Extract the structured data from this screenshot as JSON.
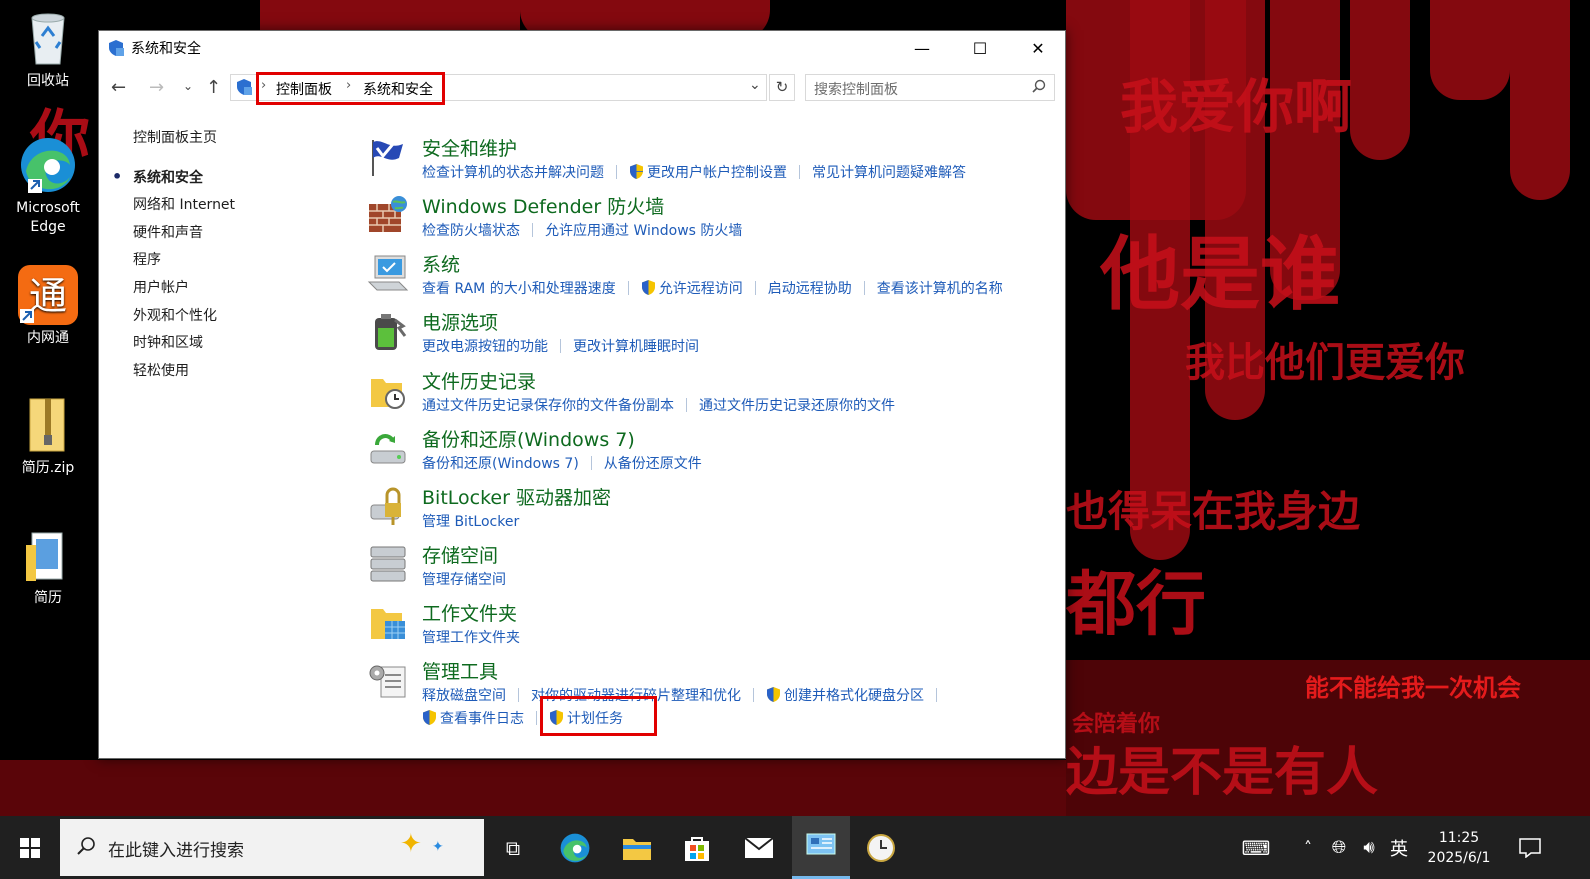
{
  "desktop": {
    "icons": [
      {
        "label": "回收站",
        "icon": "recycle-bin-icon"
      },
      {
        "label": "Microsoft Edge",
        "icon": "edge-icon"
      },
      {
        "label": "内网通",
        "icon": "neiwangtong-icon"
      },
      {
        "label": "简历.zip",
        "icon": "zip-folder-icon"
      },
      {
        "label": "简历",
        "icon": "folder-icon"
      }
    ],
    "wallpaper_text": [
      "你",
      "我爱你啊",
      "他是谁",
      "我比他们更爱你",
      "也得呆在我身边",
      "都行",
      "能不能给我一次机会",
      "会陪着你",
      "边是不是有人"
    ]
  },
  "window": {
    "title": "系统和安全",
    "controls": {
      "minimize": "—",
      "maximize": "☐",
      "close": "✕"
    },
    "breadcrumb": [
      "控制面板",
      "系统和安全"
    ],
    "search_placeholder": "搜索控制面板",
    "left_nav": {
      "home": "控制面板主页",
      "items": [
        "系统和安全",
        "网络和 Internet",
        "硬件和声音",
        "程序",
        "用户帐户",
        "外观和个性化",
        "时钟和区域",
        "轻松使用"
      ],
      "active_index": 0
    },
    "categories": [
      {
        "title": "安全和维护",
        "icon": "security-maintenance-flag-icon",
        "links": [
          {
            "text": "检查计算机的状态并解决问题",
            "shield": false
          },
          {
            "text": "更改用户帐户控制设置",
            "shield": true
          },
          {
            "text": "常见计算机问题疑难解答",
            "shield": false
          }
        ]
      },
      {
        "title": "Windows Defender 防火墙",
        "icon": "firewall-icon",
        "links": [
          {
            "text": "检查防火墙状态",
            "shield": false
          },
          {
            "text": "允许应用通过 Windows 防火墙",
            "shield": false
          }
        ]
      },
      {
        "title": "系统",
        "icon": "system-computer-icon",
        "links": [
          {
            "text": "查看 RAM 的大小和处理器速度",
            "shield": false
          },
          {
            "text": "允许远程访问",
            "shield": true
          },
          {
            "text": "启动远程协助",
            "shield": false
          },
          {
            "text": "查看该计算机的名称",
            "shield": false
          }
        ]
      },
      {
        "title": "电源选项",
        "icon": "power-battery-icon",
        "links": [
          {
            "text": "更改电源按钮的功能",
            "shield": false
          },
          {
            "text": "更改计算机睡眠时间",
            "shield": false
          }
        ]
      },
      {
        "title": "文件历史记录",
        "icon": "file-history-icon",
        "links": [
          {
            "text": "通过文件历史记录保存你的文件备份副本",
            "shield": false
          },
          {
            "text": "通过文件历史记录还原你的文件",
            "shield": false
          }
        ]
      },
      {
        "title": "备份和还原(Windows 7)",
        "icon": "backup-restore-icon",
        "links": [
          {
            "text": "备份和还原(Windows 7)",
            "shield": false
          },
          {
            "text": "从备份还原文件",
            "shield": false
          }
        ]
      },
      {
        "title": "BitLocker 驱动器加密",
        "icon": "bitlocker-icon",
        "links": [
          {
            "text": "管理 BitLocker",
            "shield": false
          }
        ]
      },
      {
        "title": "存储空间",
        "icon": "storage-spaces-icon",
        "links": [
          {
            "text": "管理存储空间",
            "shield": false
          }
        ]
      },
      {
        "title": "工作文件夹",
        "icon": "work-folders-icon",
        "links": [
          {
            "text": "管理工作文件夹",
            "shield": false
          }
        ]
      },
      {
        "title": "管理工具",
        "icon": "admin-tools-icon",
        "links": [
          {
            "text": "释放磁盘空间",
            "shield": false
          },
          {
            "text": "对你的驱动器进行碎片整理和优化",
            "shield": false
          },
          {
            "text": "创建并格式化硬盘分区",
            "shield": true
          }
        ],
        "links2": [
          {
            "text": "查看事件日志",
            "shield": true
          },
          {
            "text": "计划任务",
            "shield": true
          }
        ]
      }
    ]
  },
  "taskbar": {
    "search_placeholder": "在此键入进行搜索",
    "apps": [
      "task-view-icon",
      "edge-icon",
      "file-explorer-icon",
      "store-icon",
      "mail-icon",
      "control-panel-icon",
      "clock-app-icon"
    ],
    "tray": {
      "ime": "英",
      "time": "11:25",
      "date": "2025/6/1"
    }
  }
}
